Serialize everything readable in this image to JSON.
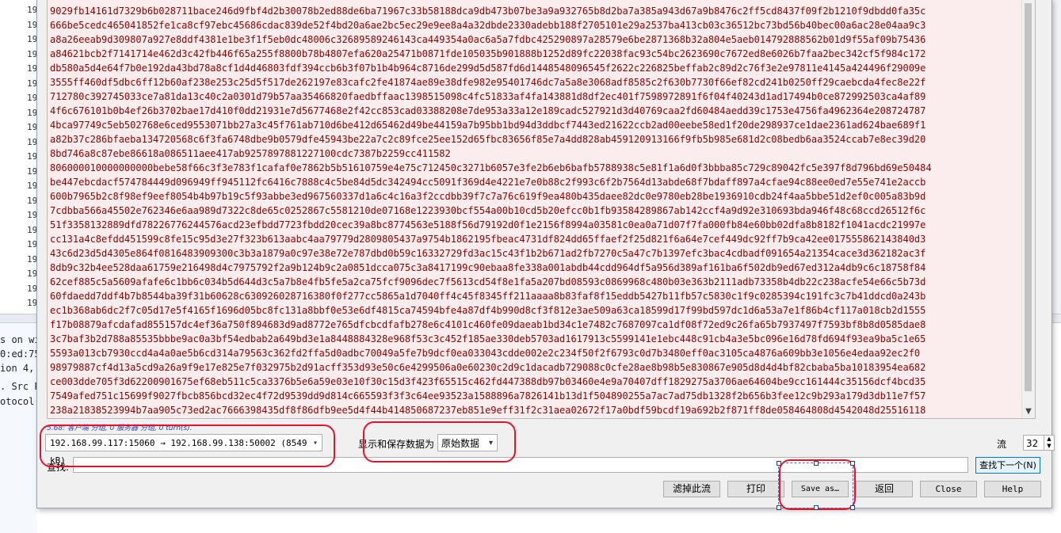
{
  "background": {
    "left_numbers": [
      "19",
      "19",
      "19",
      "19",
      "19",
      "19",
      "19",
      "19",
      "19",
      "19",
      "19",
      "19",
      "19",
      "19",
      "19",
      "19",
      "19",
      "19",
      "19",
      "19",
      "19"
    ],
    "left_fragments": [
      "s on wi",
      "0:ed:75",
      "ion 4,",
      ". Src P",
      "otocol"
    ]
  },
  "stream": {
    "lines": [
      "9029fb14161d7329b6b028711bace246d9fbf4d2b30078b2ed88de6ba71967c33b58188dca9db473b07be3a9a932765b8d2ba7a385a943d67a9b8476c2ff5cd8437f09f2b1210f9dbdd0fa35c",
      "666be5cedc465041852fe1ca8cf97ebc45686cdac839de52f4bd20a6ae2bc5ec29e9ee8a4a32dbde2330adebb188f2705101e29a2537ba413cb03c36512bc73bd56b40bec00a6ac28e04aa9c3",
      "a8a26eeab9d309807a927e8ddf4381e1be3f1f5eb0dc48006c32689589246143ca449354a0ac6a5a7fdbc425290897a28579e6be2871368b32a804e5aeb014792888562b01d9f55af09b75436",
      "a84621bcb2f7141714e462d3c42fb446f65a255f8800b78b4807efa620a25471b0871fde105035b901888b1252d89fc22038fac93c54bc2623690c7672ed8e6026b7faa2bec342cf5f984c172",
      "db580a5d4e64f7b0e192da43bd78a8cf1d4d46803fdf394ccb6b3f07b1b4b964c8716de299d5d587fd6d1448548096545f2622c226825beffab2c89d2c76f3e2e97811e4145a424496f29009e",
      "3555ff460df5dbc6ff12b60af238e253c25d5f517de262197e83cafc2fe41874ae89e38dfe982e95401746dc7a5a8e3068adf8585c2f630b7730f66ef82cd241b0250ff29caebcda4fec8e22f",
      "712780c392745033ce7a81da13c40c2a0301d79b57aa35466820faedbffaac1398515098c4fc51833af4fa143881d8df2ec401f7598972891f6f04f40243d1ad17494b0ce872992503ca4af89",
      "4f6c676101b0b4ef26b3702bae17d410f0dd21931e7d5677468e2f42cc853cad03388208e7de953a33a12e189cadc527921d3d40769caa2fd60484aedd39c1753e4756fa4962364e208724787",
      "4bca97749c5eb502768e6ced9553071bb27a3c45f761ab710d6be412d65462d49be44159a7b95bb1bd94d3ddbcf7443ed21622ccb2ad00eebe58ed1f20de298937ce1dae2361ad624bae689f1",
      "a82b37c286bfaeba134720568c6f3fa6748dbe9b0579dfe45943be22a7c2c89fce25ee152d65fbc83656f85e7a4dd828ab459120913166f9fb5b985e681d2c08bedb6aa3524ccab7e8ec39d20",
      "8bd746a8c87ebe86618a086511aee417ab9257897881227100cdc7387b2259cc411582",
      "806000010000000000bebe58f66c3f3e783f1cafaf0e7862b5b51610759e4e75c712450c3271b6057e3fe2b6eb6bafb5788938c5e81f1a6d0f3bbba85c729c89042fc5e397f8d796bd69e50484",
      "be447ebcdacf574784449d096949ff945112fc6416c7888c4c5be84d5dc342494cc5091f369d4e4221e7e0b88c2f993c6f2b7564d13abde68f7bdaff897a4cfae94c88ee0ed7e55e741e2accb",
      "600b7965b2c8f98ef9eef8054b4b97b19c5f93abbe3ed967560337d1a6c4c16a3f2ccdbb39f7c7a76c619f9ea480b435daee82dc0e9780eb28be1936910cdb24f4aa5bbe51d2ef0c005a83b9d",
      "7cdbba566a45502e762346e6aa989d7322c8de65c0252867c5581210de07168e1223930bcf554a00b10cd5b20efcc0b1fb93584289867ab142ccf4a9d92e310693bda946f48c68ccd26512f6c",
      "51f3358132889dfd78226776244576acd23efbdd7723fbdd20cec39a8bc8774563e5188f56d79192d0f1e2156f8994a03581c0ea0a71d07f7fa000fb84e60bb02dfa8b8182f1041acdc21997e",
      "cc131a4c8efdd451599c8fe15c95d3e27f323b613aabc4aa79779d2809805437a9754b1862195fbeac4731df824dd65ffaef2f25d821f6a64e7cef449dc92ff7b9ca42ee017555862143840d3",
      "43c6d23d5d4305e864f0816483909300c3b3a1879a0c97e38e72e787dbd0b59c16332729fd3ac15c43f1b2b671ad2fb7270c5a47c7b1397efc3bac4cdbadf091654a21354cace3d362182ac3f",
      "8db9c32b4ee528daa61759e216498d4c7975792f2a9b124b9c2a0851dcca075c3a8417199c90ebaa8fe338a001abdb44cdd964df5a956d389af161ba6f502db9ed67ed312a4db9c6c18758f84",
      "62cef885c5a5609afafe6c1bb6c034b5d644d3c5a7b8e4fb5fe5a2ca75fcf9096dec7f5613cd54f8e1fa5a207bd08593c0869968c480b03e363b2111adb73358b4db22c238acfe54e66c5b73d",
      "60fdaedd7ddf4b7b8544ba39f31b60628c630926028716380f0f277cc5865a1d7040ff4c45f8345ff211aaaa8b83faf8f15eddb5427b11fb57c5830c1f9c0285394c191fc3c7b41ddcd0a243b",
      "ec1b368ab6dc2f7c05d17e5f4165f1696d05bc8fc131a8bbf0e53e6df4815ca74594bfe4a87df4b990d8cf3f812e3ae509a63ca18599d17f99bd597dc1d6a53a7e1f86b4cf117a018cb2d1555",
      "f17b08879afcdafad855157dc4ef36a750f894683d9ad8772e765dfcbcdfafb278e6c4101c460fe09daeab1bd34c1e7482c7687097ca1df08f72ed9c26fa65b7937497f7593bf8b8d0585dae8",
      "3c7baf3b2d788a85535bbbe9ac0a3bf54edbab2a649bd3e1a8448884328e968f53c3c452f185ae330deb5703ad1617913c5599141e1ebc448c91cb4a3e5bc096e16d78fd694f93ea9ba5c1e65",
      "5593a013cb7930ccd4a4a0ae5b6cd314a79563c362fd2ffa5d0adbc70049a5fe7b9dcf0ea033043cdde002e2c234f50f2f6793c0d7b3480eff0ac3105ca4876a609bb3e1056e4edaa92ec2f0",
      "98979887cf4d13a5cd9a26a9f9e17e825e7f032975b2d91acff353d93e50c6e4299506a0e60230c2d9c1dacadb729088c0cfe28ae8b98b5e830867e905d8d4d4bf82cbaba5ba10183954ea682",
      "ce003dde705f3d62200901675ef68eb511c5ca3376b5e6a59e03e10f30c15d3f423f65515c462fd447388db97b03460e4e9a70407dff1829275a3706ae64604be9cc161444c35156dcf4bcd35",
      "7549afed751c15699f9027fbcb856bcd32ec4f72d9539dd9d814c665593f3f3c64ee93523a1588896a7826141b13d1f504890255a7ac7ad75db1328f2b656b3fee12c9b293a179d3db11e7f57",
      "238a21838523994b7aa905c73ed2ac7666398435df8f86dfb9ee5d4f44b414850687237eb851e9eff31f2c31aea02672f17a0bdf59bcdf19a692b2f871ff8de058464808d4542048d25516118"
    ]
  },
  "summary": "5.68: 客户端 分组, 0 服务器 分组, 0 turn(s).",
  "conversation": {
    "selected": "192.168.99.117:15060 → 192.168.99.138:50002 (8549 kB)"
  },
  "format": {
    "label": "显示和保存数据为",
    "selected": "原始数据"
  },
  "stream_ctrl": {
    "label": "流",
    "value": "32"
  },
  "find": {
    "label": "查找:",
    "value": "",
    "next_label": "查找下一个(N)"
  },
  "buttons": {
    "filter": "滤掉此流",
    "print": "打印",
    "save_as": "Save as…",
    "back": "返回",
    "close": "Close",
    "help": "Help"
  },
  "icons": {
    "dropdown": "▾",
    "spin_up": "▲",
    "spin_down": "▼",
    "scroll_down": "▼"
  },
  "colors": {
    "stream_text": "#8b0000",
    "stream_bg": "#fbeded",
    "annotation": "#e8112d"
  }
}
